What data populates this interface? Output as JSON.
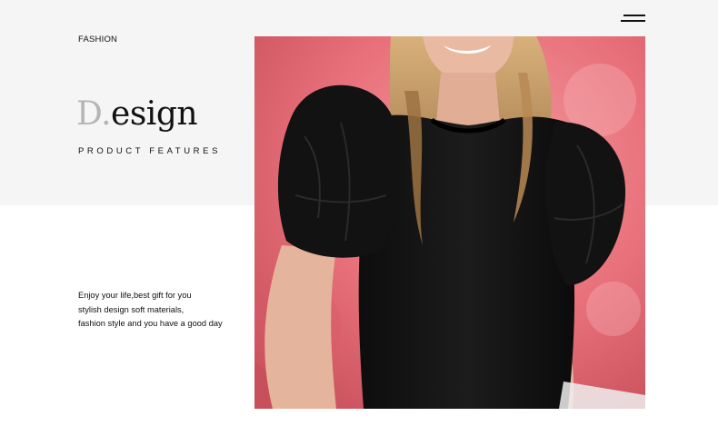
{
  "header": {
    "brand": "FASHION",
    "menu_icon": "hamburger-menu-icon"
  },
  "hero": {
    "title_initial": "D.",
    "title_rest": "esign",
    "subtitle": "PRODUCT FEATURES"
  },
  "description": {
    "lines": [
      "Enjoy your life,best gift for you",
      "stylish design soft materials,",
      "fashion style and you have a good day"
    ]
  },
  "photo": {
    "subject": "model wearing black puff-sleeve knit top",
    "colors": {
      "background": "#e8707a",
      "top": "#111111",
      "hair": "#c9a26b",
      "skin": "#e9b8a0"
    }
  },
  "colors": {
    "band": "#f5f5f5",
    "text": "#111111",
    "title_accent": "#b5b5b5"
  }
}
